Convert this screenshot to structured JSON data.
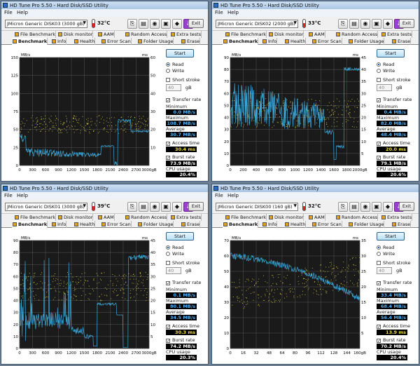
{
  "windows": [
    {
      "id": "w0",
      "title": "HD Tune Pro 5.50 - Hard Disk/SSD Utility",
      "device": "JMicron Generic DISK03 (3000 gB)",
      "temperature": "32°C",
      "left_axis": {
        "unit": "MB/s",
        "ticks": [
          150,
          125,
          100,
          75,
          50,
          25,
          0
        ],
        "max": 150
      },
      "right_axis": {
        "unit": "ms",
        "ticks": [
          60,
          50,
          40,
          30,
          20,
          10
        ],
        "max": 60
      },
      "x_ticks": [
        "0",
        "300",
        "600",
        "900",
        "1200",
        "1500",
        "1800",
        "2100",
        "2400",
        "2700",
        "3000gB"
      ],
      "stats": {
        "minimum": "0.0 MB/s",
        "maximum": "108.7 MB/s",
        "average": "30.7 MB/s",
        "access_time": "30.4 ms",
        "burst_rate": "73.9 MB/s",
        "cpu_usage": "20.4%"
      }
    },
    {
      "id": "w1",
      "title": "HD Tune Pro 5.50 - Hard Disk/SSD Utility",
      "device": "JMicron Generic DISK02 (2000 gB)",
      "temperature": "33°C",
      "left_axis": {
        "unit": "MB/s",
        "ticks": [
          90,
          80,
          70,
          60,
          50,
          40,
          30,
          20,
          10,
          0
        ],
        "max": 90
      },
      "right_axis": {
        "unit": "ms",
        "ticks": [
          45,
          40,
          35,
          30,
          25,
          20,
          15,
          10,
          5
        ],
        "max": 45
      },
      "x_ticks": [
        "0",
        "200",
        "400",
        "600",
        "800",
        "1000",
        "1200",
        "1400",
        "1600",
        "1800",
        "2000gB"
      ],
      "stats": {
        "minimum": "0.4 MB/s",
        "maximum": "82.0 MB/s",
        "average": "48.4 MB/s",
        "access_time": "20.0 ms",
        "burst_rate": "79.1 MB/s",
        "cpu_usage": "20.6%"
      }
    },
    {
      "id": "w2",
      "title": "HD Tune Pro 5.50 - Hard Disk/SSD Utility",
      "device": "JMicron Generic DISK01 (3000 gB)",
      "temperature": "39°C",
      "left_axis": {
        "unit": "MB/s",
        "ticks": [
          90,
          80,
          70,
          60,
          50,
          40,
          30,
          20,
          10,
          0
        ],
        "max": 90
      },
      "right_axis": {
        "unit": "ms",
        "ticks": [
          45,
          40,
          35,
          30,
          25,
          20,
          15,
          10,
          5
        ],
        "max": 45
      },
      "x_ticks": [
        "0",
        "300",
        "600",
        "900",
        "1200",
        "1500",
        "1800",
        "2100",
        "2400",
        "2700",
        "3000gB"
      ],
      "stats": {
        "minimum": "0.1 MB/s",
        "maximum": "80.1 MB/s",
        "average": "34.5 MB/s",
        "access_time": "30.3 ms",
        "burst_rate": "74.2 MB/s",
        "cpu_usage": "20.3%"
      }
    },
    {
      "id": "w3",
      "title": "HD Tune Pro 5.50 - Hard Disk/SSD Utility",
      "device": "JMicron Generic DISK00 (160 gB)",
      "temperature": "32°C",
      "left_axis": {
        "unit": "MB/s",
        "ticks": [
          70,
          60,
          50,
          40,
          30,
          20,
          10,
          0
        ],
        "max": 70
      },
      "right_axis": {
        "unit": "ms",
        "ticks": [
          35,
          30,
          25,
          20,
          15,
          10,
          5
        ],
        "max": 35
      },
      "x_ticks": [
        "0",
        "16",
        "32",
        "48",
        "64",
        "80",
        "96",
        "112",
        "128",
        "144",
        "160gB"
      ],
      "stats": {
        "minimum": "33.4 MB/s",
        "maximum": "68.4 MB/s",
        "average": "56.4 MB/s",
        "access_time": "13.9 ms",
        "burst_rate": "70.2 MB/s",
        "cpu_usage": "20.4%"
      }
    }
  ],
  "ui": {
    "menu_file": "File",
    "menu_help": "Help",
    "exit": "Exit",
    "tabs_row1": [
      "File Benchmark",
      "Disk monitor",
      "AAM",
      "Random Access",
      "Extra tests"
    ],
    "tabs_row2": [
      "Benchmark",
      "Info",
      "Health",
      "Error Scan",
      "Folder Usage",
      "Erase"
    ],
    "start": "Start",
    "read": "Read",
    "write": "Write",
    "short_stroke": "Short stroke",
    "stroke_value": "40",
    "stroke_unit": "gB",
    "transfer_rate": "Transfer rate",
    "minimum": "Minimum",
    "maximum": "Maximum",
    "average": "Average",
    "access_time": "Access time",
    "burst_rate": "Burst rate",
    "cpu_usage": "CPU usage"
  },
  "colors": {
    "transfer_line": "#3aa6d8",
    "access_dots": "#d8d040",
    "grid": "#666666",
    "plot_bg": "#1a1a1a"
  }
}
